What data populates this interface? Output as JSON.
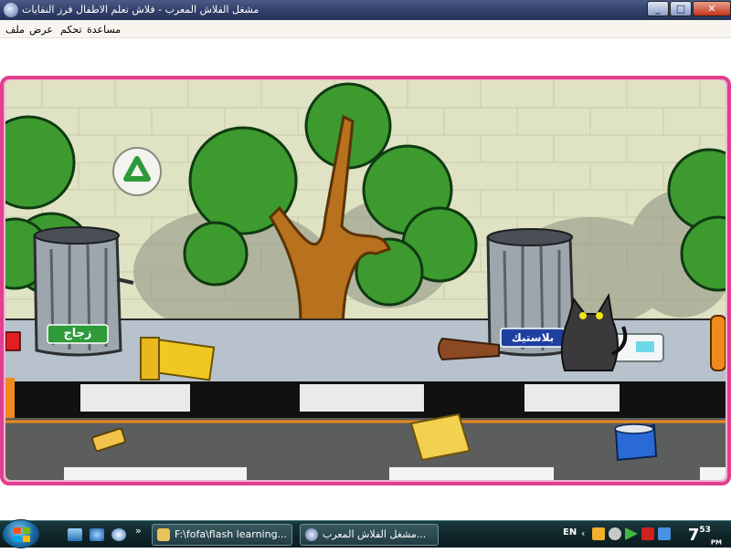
{
  "window": {
    "title": "مشغل الفلاش المعرب - فلاش تعلم الاطفال فرز النفايات",
    "minimize_label": "_",
    "maximize_label": "□",
    "close_label": "✕"
  },
  "menu": {
    "items": [
      "ملف",
      "عرض",
      "تحكم",
      "مساعدة"
    ]
  },
  "game": {
    "bins": [
      {
        "label": "زجاج",
        "color": "#2e9a3a"
      },
      {
        "label": "بلاستيك",
        "color": "#1f3fa0"
      }
    ],
    "icons": [
      "recycle-icon",
      "tree-icon",
      "cat-icon",
      "trash-can-icon"
    ],
    "colors": {
      "frame": "#e0408e",
      "wall": "#dfe2c3",
      "sidewalk": "#b7c2cc",
      "road": "#5c5e5e",
      "road_line": "#e88a1c"
    }
  },
  "taskbar": {
    "tasks": [
      {
        "label": "F:\\fofa\\flash learning..."
      },
      {
        "label": "مشغل الفلاش المعرب..."
      }
    ],
    "language": "EN",
    "clock": {
      "hour": "7",
      "minute": "53",
      "period": "PM"
    }
  }
}
